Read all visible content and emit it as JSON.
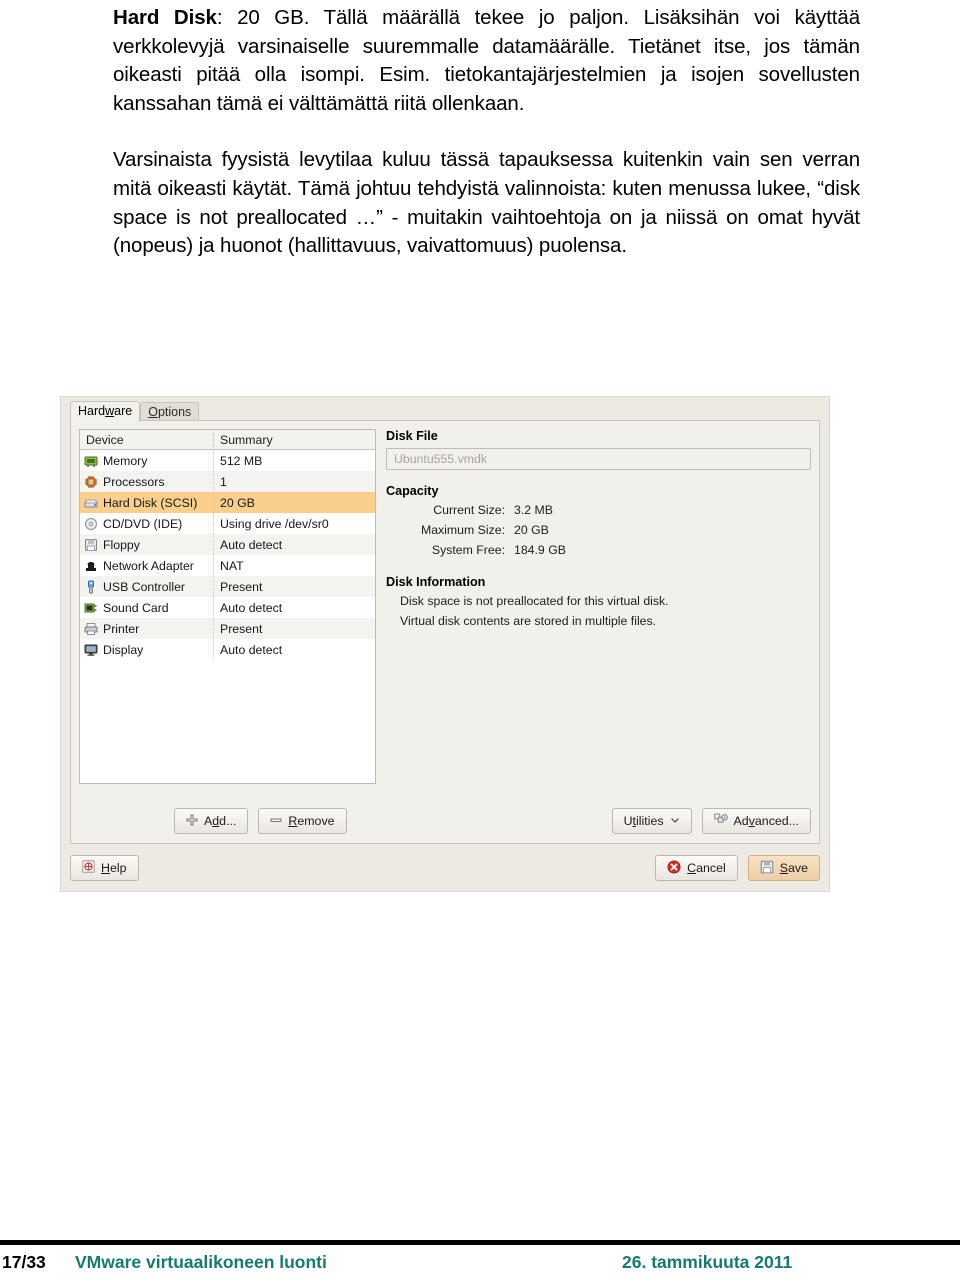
{
  "slide": {
    "paragraph1_lead": "Hard Disk",
    "paragraph1": ": 20 GB. Tällä määrällä tekee jo paljon. Lisäksihän voi käyttää verkkolevyjä varsinaiselle suuremmalle datamäärälle. Tietänet itse, jos tämän oikeasti pitää olla isompi. Esim. tietokantajärjestelmien ja isojen sovellusten kanssahan tämä ei välttämättä riitä ollenkaan.",
    "paragraph2": "Varsinaista fyysistä levytilaa kuluu tässä tapauksessa kuitenkin vain sen verran mitä oikeasti käytät. Tämä johtuu tehdyistä valinnoista: kuten menussa lukee, “disk space is not preallocated …” - muitakin vaihtoehtoja on ja niissä on omat hyvät (nopeus) ja huonot (hallittavuus, vaivattomuus) puolensa."
  },
  "dialog": {
    "tabs": [
      {
        "label_pre": "Hard",
        "label_underline": "w",
        "label_post": "are",
        "active": true
      },
      {
        "label_pre": "",
        "label_underline": "O",
        "label_post": "ptions",
        "active": false
      }
    ],
    "device_table": {
      "columns": [
        "Device",
        "Summary"
      ],
      "rows": [
        {
          "icon": "memory-icon",
          "device": "Memory",
          "summary": "512 MB",
          "selected": false
        },
        {
          "icon": "processor-icon",
          "device": "Processors",
          "summary": "1",
          "selected": false
        },
        {
          "icon": "harddisk-icon",
          "device": "Hard Disk (SCSI)",
          "summary": "20 GB",
          "selected": true
        },
        {
          "icon": "cddvd-icon",
          "device": "CD/DVD (IDE)",
          "summary": "Using drive /dev/sr0",
          "selected": false
        },
        {
          "icon": "floppy-icon",
          "device": "Floppy",
          "summary": "Auto detect",
          "selected": false
        },
        {
          "icon": "network-adapter-icon",
          "device": "Network Adapter",
          "summary": "NAT",
          "selected": false
        },
        {
          "icon": "usb-icon",
          "device": "USB Controller",
          "summary": "Present",
          "selected": false
        },
        {
          "icon": "soundcard-icon",
          "device": "Sound Card",
          "summary": "Auto detect",
          "selected": false
        },
        {
          "icon": "printer-icon",
          "device": "Printer",
          "summary": "Present",
          "selected": false
        },
        {
          "icon": "display-icon",
          "device": "Display",
          "summary": "Auto detect",
          "selected": false
        }
      ]
    },
    "details": {
      "disk_file_title": "Disk File",
      "disk_file_value": "Ubuntu555.vmdk",
      "capacity_title": "Capacity",
      "capacity_rows": [
        {
          "key": "Current Size:",
          "value": "3.2 MB"
        },
        {
          "key": "Maximum Size:",
          "value": "20 GB"
        },
        {
          "key": "System Free:",
          "value": "184.9 GB"
        }
      ],
      "disk_information_title": "Disk Information",
      "disk_information_lines": [
        "Disk space is not preallocated for this virtual disk.",
        "Virtual disk contents are stored in multiple files."
      ]
    },
    "buttons": {
      "add": {
        "pre": "A",
        "u": "d",
        "post": "d..."
      },
      "remove": {
        "pre": "",
        "u": "R",
        "post": "emove"
      },
      "utilities": {
        "pre": "U",
        "u": "t",
        "post": "ilities"
      },
      "advanced": {
        "pre": "Ad",
        "u": "v",
        "post": "anced..."
      },
      "help": {
        "pre": "",
        "u": "H",
        "post": "elp"
      },
      "cancel": {
        "pre": "",
        "u": "C",
        "post": "ancel"
      },
      "save": {
        "pre": "",
        "u": "S",
        "post": "ave"
      }
    }
  },
  "footer": {
    "page": "17/33",
    "title": "VMware virtuaalikoneen luonti",
    "date": "26. tammikuuta 2011"
  },
  "colors": {
    "selection": "#f9cf8c",
    "footer_accent": "#147b72",
    "dialog_bg": "#edeae3"
  }
}
